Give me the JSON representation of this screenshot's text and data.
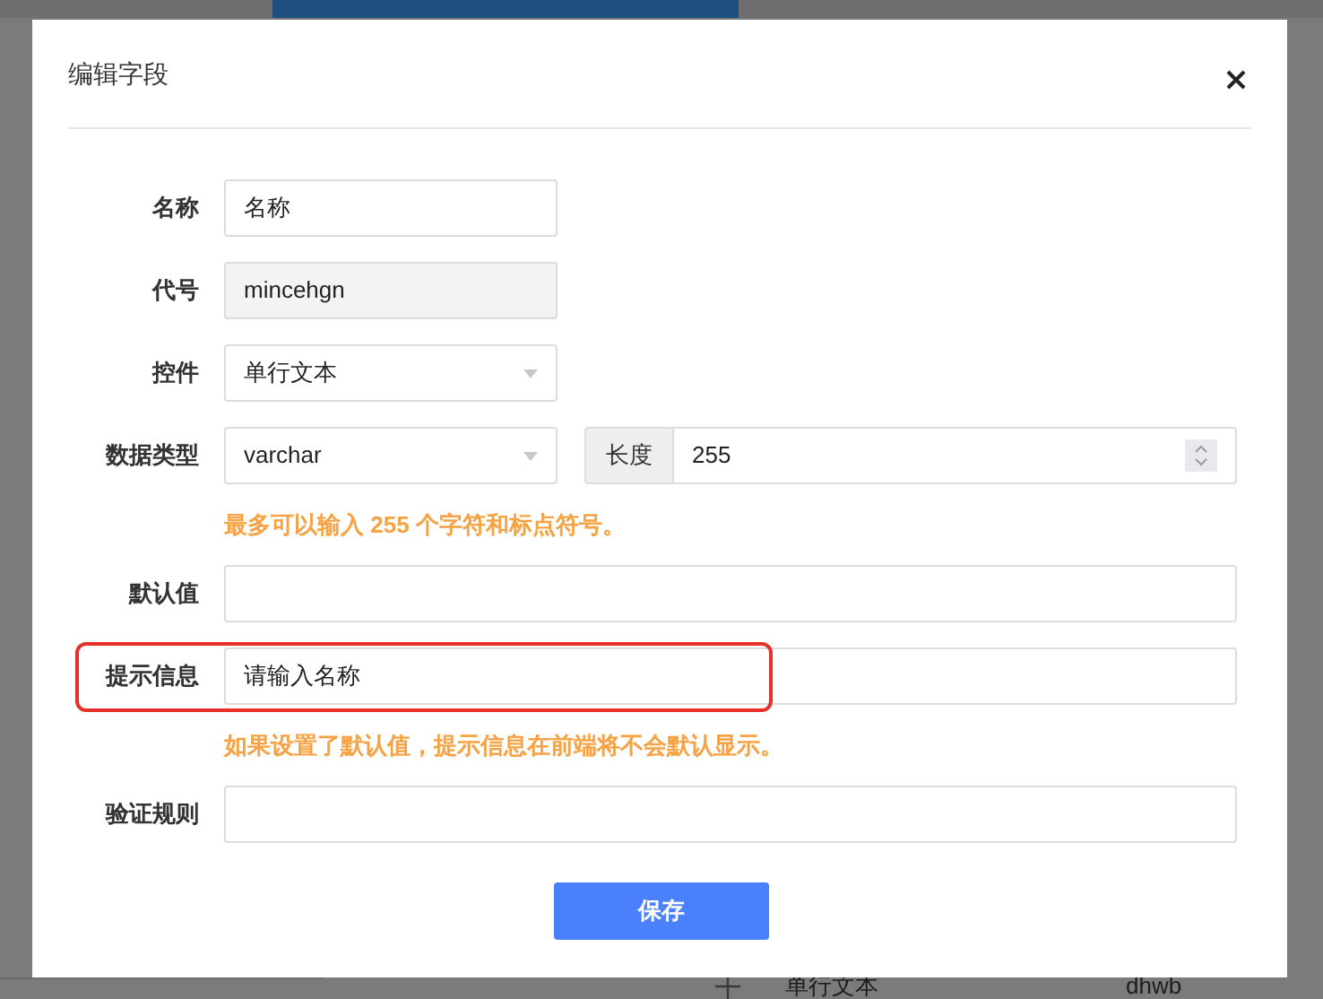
{
  "background_row": {
    "control": "单行文本",
    "code": "dhwb"
  },
  "dialog": {
    "title": "编辑字段"
  },
  "fields": [
    {
      "kind": "short",
      "label": "名称",
      "value": "名称",
      "disabled": false,
      "highlighted": false
    },
    {
      "kind": "short",
      "label": "代号",
      "value": "mincehgn",
      "disabled": true,
      "highlighted": false
    },
    {
      "kind": "select",
      "label": "控件",
      "value": "单行文本",
      "disabled": false,
      "highlighted": false
    },
    {
      "kind": "select_length",
      "label": "数据类型",
      "value": "varchar",
      "addon": "长度",
      "length": "255",
      "hint": "最多可以输入 255 个字符和标点符号。",
      "disabled": false,
      "highlighted": false
    },
    {
      "kind": "wide",
      "label": "默认值",
      "disabled": false,
      "highlighted": false
    },
    {
      "kind": "wide",
      "label": "提示信息",
      "value": "请输入名称",
      "hint": "如果设置了默认值，提示信息在前端将不会默认显示。",
      "disabled": false,
      "highlighted": true
    },
    {
      "kind": "wide",
      "label": "验证规则",
      "disabled": false,
      "highlighted": false
    }
  ],
  "save_button": "保存"
}
